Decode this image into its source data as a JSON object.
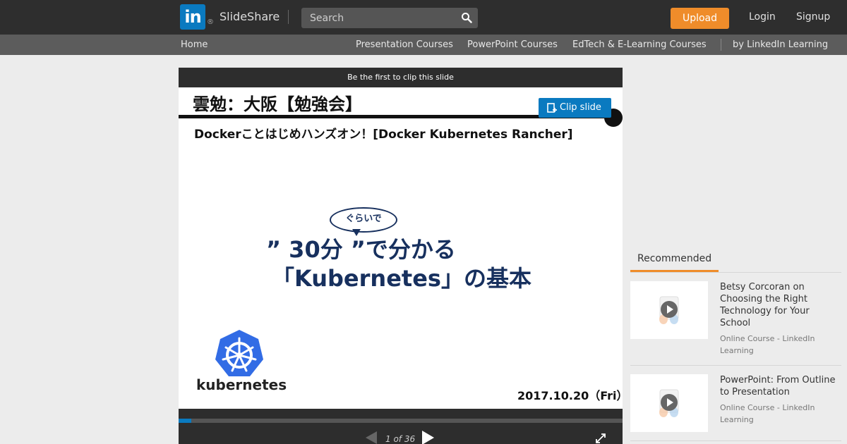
{
  "header": {
    "logo_text": "in",
    "logo_reg": "®",
    "brand": "SlideShare",
    "search_placeholder": "Search",
    "upload_label": "Upload",
    "login_label": "Login",
    "signup_label": "Signup"
  },
  "subnav": {
    "home": "Home",
    "items": [
      "Presentation Courses",
      "PowerPoint Courses",
      "EdTech & E-Learning Courses"
    ],
    "by_label": "by LinkedIn Learning"
  },
  "player": {
    "clip_bar_text": "Be the first to clip this slide",
    "clip_slide_label": "Clip slide",
    "page_count": "1 of 36",
    "progress": 0.028
  },
  "slide": {
    "header": "雲勉：大阪【勉強会】",
    "subtitle": "Dockerことはじめハンズオン！[Docker Kubernetes Rancher]",
    "bubble": "ぐらいで",
    "main_line1": "” 30分 ”で分かる",
    "main_line2": "「Kubernetes」の基本",
    "logo_word": "kubernetes",
    "date": "2017.10.20（Fri）"
  },
  "sidebar": {
    "tab_label": "Recommended",
    "items": [
      {
        "title": "Betsy Corcoran on Choosing the Right Technology for Your School",
        "meta": "Online Course - LinkedIn Learning"
      },
      {
        "title": "PowerPoint: From Outline to Presentation",
        "meta": "Online Course - LinkedIn Learning"
      }
    ]
  },
  "colors": {
    "accent_orange": "#ef8c2a",
    "linkedin_blue": "#0a7ac0",
    "slide_navy": "#17305e"
  }
}
